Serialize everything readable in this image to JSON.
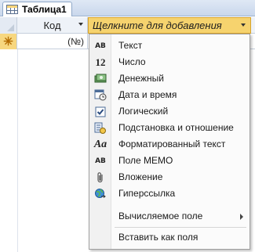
{
  "tab": {
    "title": "Таблица1",
    "icon": "table-icon"
  },
  "grid": {
    "column_kod": "Код",
    "column_add": "Щелкните для добавления",
    "new_row_marker": "✳",
    "new_row_value": "(№)"
  },
  "menu": {
    "items": [
      {
        "label": "Текст",
        "icon": "text-ab-icon"
      },
      {
        "label": "Число",
        "icon": "number-12-icon"
      },
      {
        "label": "Денежный",
        "icon": "currency-icon"
      },
      {
        "label": "Дата и время",
        "icon": "calendar-clock-icon"
      },
      {
        "label": "Логический",
        "icon": "checkbox-icon"
      },
      {
        "label": "Подстановка и отношение",
        "icon": "lookup-icon"
      },
      {
        "label": "Форматированный текст",
        "icon": "rich-text-icon"
      },
      {
        "label": "Поле МЕМО",
        "icon": "memo-ab-icon"
      },
      {
        "label": "Вложение",
        "icon": "paperclip-icon"
      },
      {
        "label": "Гиперссылка",
        "icon": "globe-link-icon"
      },
      {
        "label": "Вычисляемое поле",
        "icon": "",
        "has_submenu": true
      },
      {
        "label": "Вставить как поля",
        "icon": ""
      }
    ]
  }
}
